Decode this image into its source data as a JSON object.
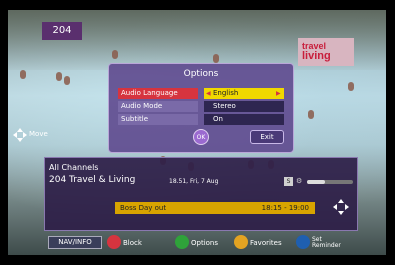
{
  "channel_number": "204",
  "logo": {
    "line1": "travel",
    "line2": "living"
  },
  "options": {
    "title": "Options",
    "rows": [
      {
        "label": "Audio Language",
        "value": "English"
      },
      {
        "label": "Audio Mode",
        "value": "Stereo"
      },
      {
        "label": "Subtitle",
        "value": "On"
      }
    ],
    "move_label": "Move",
    "ok_label": "OK",
    "exit_label": "Exit"
  },
  "info": {
    "group": "All Channels",
    "channel": "204 Travel & Living",
    "time": "18.51, Fri, 7 Aug",
    "s_badge": "S",
    "volume_level": 0.4,
    "program_title": "Boss Day out",
    "program_time": "18:15 - 19:00"
  },
  "bottom": {
    "nav_info": "NAV/INFO",
    "red_label": "Block",
    "green_label": "Options",
    "yellow_label": "Favorites",
    "blue_label": "Set Reminder"
  },
  "colors": {
    "red": "#d6343f",
    "green": "#2fa23a",
    "yellow": "#e3a322",
    "blue": "#1f5fb0",
    "selection": "#f0d800"
  }
}
